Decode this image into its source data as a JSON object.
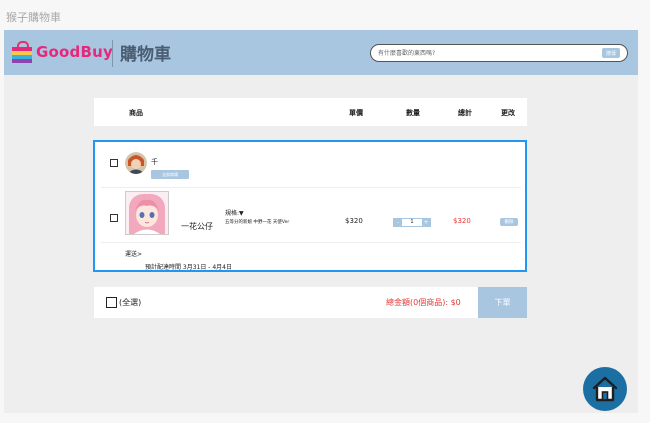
{
  "window": {
    "title": "猴子購物車"
  },
  "header": {
    "brand": "GoodBuy",
    "page_title": "購物車",
    "search_placeholder": "有什麼喜歡的東西嗎?",
    "search_button": "搜尋"
  },
  "columns": {
    "product": "商品",
    "unit_price": "單價",
    "quantity": "數量",
    "subtotal": "總計",
    "action": "更改"
  },
  "shop": {
    "seller_name": "千",
    "seller_tag": "全部商場",
    "item": {
      "name": "一花公仔",
      "spec_label": "規格:▼",
      "spec_value": "五等分的新娘 中野一花 天使Ver",
      "unit_price": "$320",
      "quantity": "1",
      "subtotal": "$320",
      "delete_label": "刪除"
    },
    "shipping": "運送>",
    "eta": "預計配達時間 3月31日 - 4月4日"
  },
  "footer": {
    "select_all": "(全選)",
    "total": "總金額(0個商品): $0",
    "checkout": "下單"
  },
  "colors": {
    "header": "#a9c6e0",
    "accent": "#e8267a",
    "highlight": "#2196f3",
    "price": "#e53935",
    "fab": "#1c6fa3"
  },
  "icons": {
    "logo": "shopping-bag-icon",
    "fab": "home-icon"
  }
}
